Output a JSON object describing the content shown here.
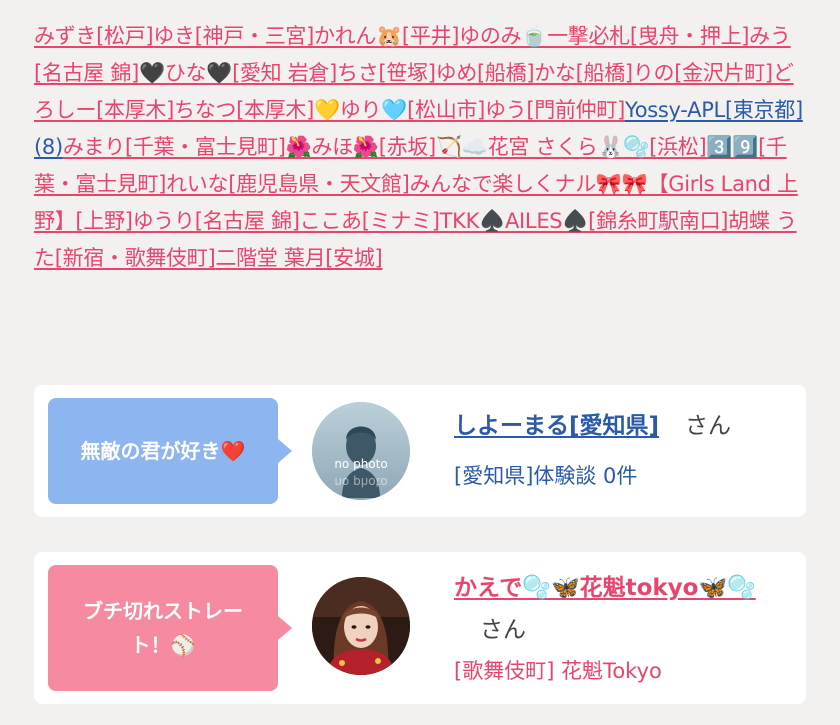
{
  "tag_links": [
    {
      "text": "みずき[松戸]",
      "color": "pink"
    },
    {
      "text": "ゆき[神戸・三宮]",
      "color": "pink"
    },
    {
      "text": "かれん🐹[平井]",
      "color": "pink"
    },
    {
      "text": "ゆのみ🍵一撃必札[曳舟・押上]",
      "color": "pink"
    },
    {
      "text": "みう[名古屋 錦]",
      "color": "pink"
    },
    {
      "text": "🖤ひな🖤[愛知 岩倉]",
      "color": "pink"
    },
    {
      "text": "ちさ[笹塚]",
      "color": "pink"
    },
    {
      "text": "ゆめ[船橋]",
      "color": "pink"
    },
    {
      "text": "かな[船橋]",
      "color": "pink"
    },
    {
      "text": "りの[金沢片町]",
      "color": "pink"
    },
    {
      "text": "どろしー[本厚木]",
      "color": "pink"
    },
    {
      "text": "ちなつ[本厚木]",
      "color": "pink"
    },
    {
      "text": "💛ゆり🩵[松山市]",
      "color": "pink"
    },
    {
      "text": "ゆう[門前仲町]",
      "color": "pink"
    },
    {
      "text": "Yossy-APL[東京都](8)",
      "color": "blue"
    },
    {
      "text": "みまり[千葉・富士見町]",
      "color": "pink"
    },
    {
      "text": "🌺みほ🌺[赤坂]",
      "color": "pink"
    },
    {
      "text": "🏹☁️花宮 さくら🐰🫧[浜松]",
      "color": "pink"
    },
    {
      "text": "3️⃣9️⃣[千葉・富士見町]",
      "color": "pink"
    },
    {
      "text": "れいな[鹿児島県・天文館]",
      "color": "pink"
    },
    {
      "text": "みんなで楽しくナル🎀🎀【Girls Land 上野】[上野]",
      "color": "pink"
    },
    {
      "text": "ゆうり[名古屋 錦]",
      "color": "pink"
    },
    {
      "text": "ここあ[ミナミ]",
      "color": "pink"
    },
    {
      "text": "TKK♠️AILES♠️[錦糸町駅南口]",
      "color": "pink"
    },
    {
      "text": "胡蝶 うた[新宿・歌舞伎町]",
      "color": "pink"
    },
    {
      "text": "二階堂 葉月[安城]",
      "color": "pink"
    }
  ],
  "cards": [
    {
      "bubble_text": "無敵の君が好き❤️",
      "bubble_color": "#8db5f0",
      "avatar_type": "no-photo",
      "avatar_text": "no photo",
      "name": "しよーまる[愛知県]",
      "name_color": "#2a5aa8",
      "suffix": "さん",
      "sub": "[愛知県]体験談 0件",
      "sub_color": "#2a5aa8"
    },
    {
      "bubble_text": "ブチ切れストレート！⚾",
      "bubble_color": "#f58aa0",
      "avatar_type": "photo",
      "name": "かえで🫧🦋花魁tokyo🦋🫧",
      "name_color": "#e8456d",
      "suffix": "さん",
      "sub": "[歌舞伎町] 花魁Tokyo",
      "sub_color": "#e8456d"
    }
  ]
}
